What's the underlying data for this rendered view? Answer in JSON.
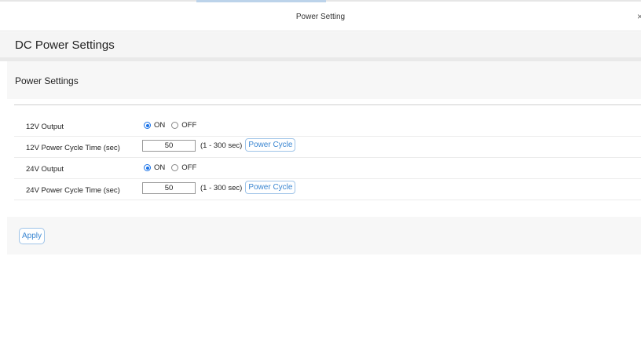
{
  "dialog": {
    "title": "Power Setting",
    "close_glyph": "×"
  },
  "page": {
    "title": "DC Power Settings"
  },
  "section": {
    "title": "Power Settings"
  },
  "rows": [
    {
      "label": "12V Output",
      "type": "radio",
      "options": [
        "ON",
        "OFF"
      ],
      "selected": "ON"
    },
    {
      "label": "12V Power Cycle Time (sec)",
      "type": "number",
      "value": "50",
      "range": "(1 - 300 sec)",
      "button": "Power Cycle"
    },
    {
      "label": "24V Output",
      "type": "radio",
      "options": [
        "ON",
        "OFF"
      ],
      "selected": "ON"
    },
    {
      "label": "24V Power Cycle Time (sec)",
      "type": "number",
      "value": "50",
      "range": "(1 - 300 sec)",
      "button": "Power Cycle"
    }
  ],
  "footer": {
    "apply_label": "Apply"
  },
  "colors": {
    "accent": "#1a73e8",
    "button_text": "#3a86d1",
    "panel_bg": "#f7f7f7"
  }
}
